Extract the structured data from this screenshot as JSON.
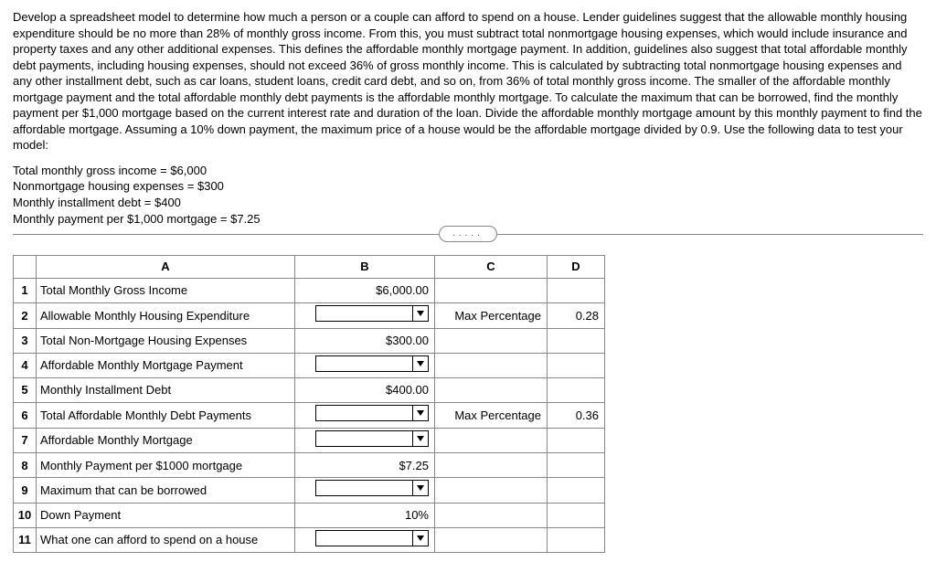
{
  "problem_text": "Develop a spreadsheet model to determine how much a person or a couple can afford to spend on a house. Lender guidelines suggest that the allowable monthly housing expenditure should be no more than 28% of monthly gross income. From this, you must subtract total nonmortgage housing expenses, which would include insurance and property taxes and any other additional expenses. This defines the affordable monthly mortgage payment. In addition, guidelines also suggest that total affordable monthly debt payments, including housing expenses, should not exceed 36% of gross monthly income. This is calculated by subtracting total nonmortgage housing expenses and any other installment debt, such as car loans, student loans, credit card debt, and so on, from 36% of total monthly gross income. The smaller of the affordable monthly mortgage payment and the total affordable monthly debt payments is the affordable monthly mortgage. To calculate the maximum that can be borrowed, find the monthly payment per $1,000 mortgage based on the current interest rate and duration of the loan. Divide the affordable monthly mortgage amount by this monthly payment to find the affordable mortgage. Assuming a 10% down payment, the maximum price of a house would be the affordable mortgage divided by 0.9. Use the following data to test your model:",
  "given": {
    "line1": "Total monthly gross income = $6,000",
    "line2": "Nonmortgage housing expenses = $300",
    "line3": "Monthly installment debt = $400",
    "line4": "Monthly payment per $1,000 mortgage = $7.25"
  },
  "dots": ".....",
  "cols": {
    "A": "A",
    "B": "B",
    "C": "C",
    "D": "D"
  },
  "rows": [
    {
      "n": "1",
      "label": "Total Monthly Gross Income",
      "b_type": "text",
      "b": "$6,000.00",
      "c": "",
      "d": ""
    },
    {
      "n": "2",
      "label": "Allowable Monthly Housing Expenditure",
      "b_type": "dd",
      "b": "",
      "c": "Max Percentage",
      "d": "0.28"
    },
    {
      "n": "3",
      "label": "Total Non-Mortgage Housing Expenses",
      "b_type": "text",
      "b": "$300.00",
      "c": "",
      "d": ""
    },
    {
      "n": "4",
      "label": "Affordable Monthly Mortgage Payment",
      "b_type": "dd",
      "b": "",
      "c": "",
      "d": ""
    },
    {
      "n": "5",
      "label": "Monthly Installment Debt",
      "b_type": "text",
      "b": "$400.00",
      "c": "",
      "d": ""
    },
    {
      "n": "6",
      "label": "Total Affordable Monthly Debt Payments",
      "b_type": "dd",
      "b": "",
      "c": "Max Percentage",
      "d": "0.36"
    },
    {
      "n": "7",
      "label": "Affordable Monthly Mortgage",
      "b_type": "dd",
      "b": "",
      "c": "",
      "d": ""
    },
    {
      "n": "8",
      "label": "Monthly Payment per $1000 mortgage",
      "b_type": "text",
      "b": "$7.25",
      "c": "",
      "d": ""
    },
    {
      "n": "9",
      "label": "Maximum that can be borrowed",
      "b_type": "dd",
      "b": "",
      "c": "",
      "d": ""
    },
    {
      "n": "10",
      "label": "Down Payment",
      "b_type": "text",
      "b": "10%",
      "c": "",
      "d": ""
    },
    {
      "n": "11",
      "label": "What one can afford to spend on a house",
      "b_type": "dd",
      "b": "",
      "c": "",
      "d": ""
    }
  ]
}
